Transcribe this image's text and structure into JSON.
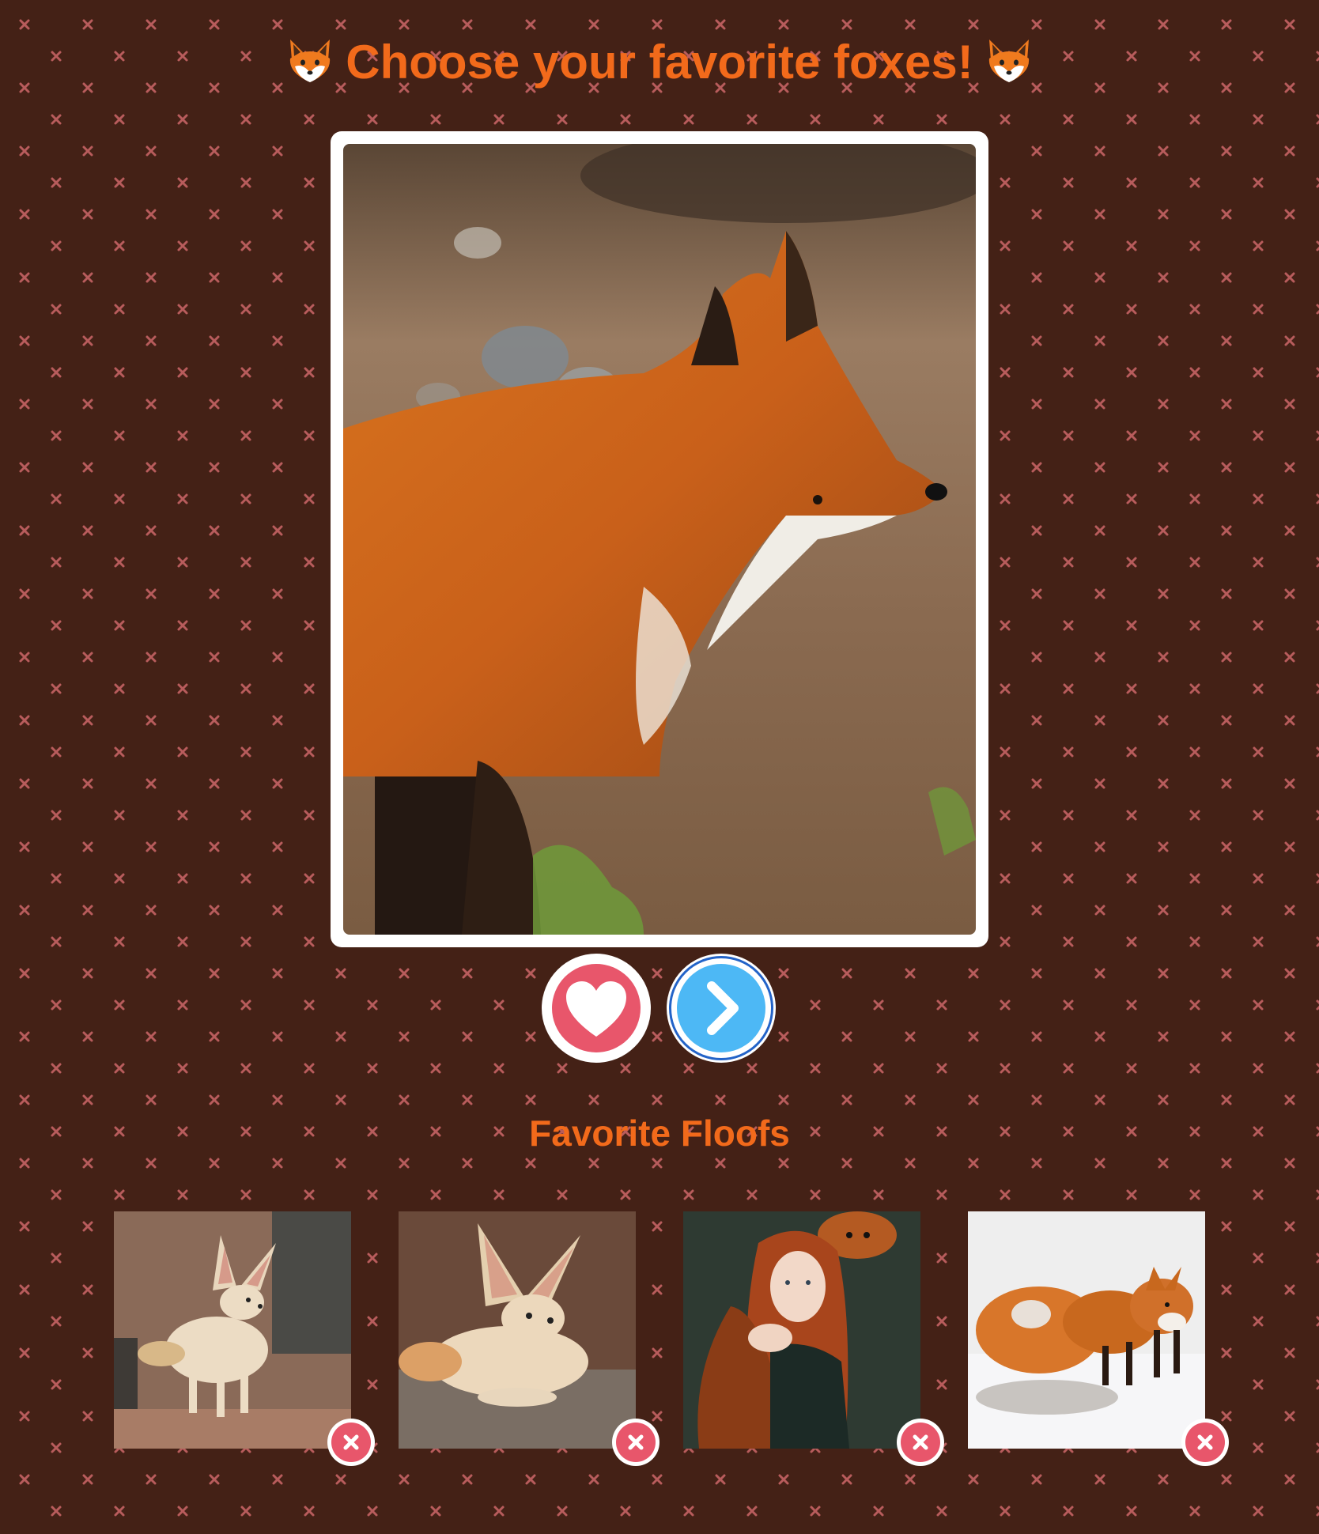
{
  "page": {
    "title": "Choose your favorite foxes!",
    "title_icon": "fox-face-emoji",
    "background_color": "#442116",
    "pattern_color": "#b85c5c",
    "accent_color": "#f26a1b"
  },
  "main_photo": {
    "subject": "red fox in profile standing on gravel",
    "frame_color": "#ffffff"
  },
  "actions": {
    "like": {
      "icon": "heart-icon",
      "color": "#e8566b"
    },
    "next": {
      "icon": "chevron-right-icon",
      "color": "#4db8f5",
      "ring_color": "#2363c8"
    }
  },
  "favorites": {
    "heading": "Favorite Floofs",
    "items": [
      {
        "subject": "fennec fox standing by rocks",
        "remove_icon": "close-icon"
      },
      {
        "subject": "fennec fox lying on a log",
        "remove_icon": "close-icon"
      },
      {
        "subject": "red-haired woman holding a red fox",
        "remove_icon": "close-icon"
      },
      {
        "subject": "three red foxes in snow",
        "remove_icon": "close-icon"
      }
    ],
    "remove_color": "#e8566b"
  }
}
